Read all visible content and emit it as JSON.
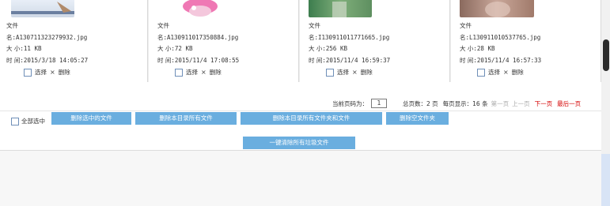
{
  "cards": [
    {
      "type_label": "文件",
      "name_label": "名",
      "name": "A130711323279932.jpg",
      "size_label": "大 小",
      "size": "11 KB",
      "time_label": "时 间",
      "time": "2015/3/18 14:05:27",
      "select_label": "选择",
      "delete_label": "删除"
    },
    {
      "type_label": "文件",
      "name_label": "名",
      "name": "A130911017350884.jpg",
      "size_label": "大 小",
      "size": "72 KB",
      "time_label": "时 间",
      "time": "2015/11/4 17:08:55",
      "select_label": "选择",
      "delete_label": "删除"
    },
    {
      "type_label": "文件",
      "name_label": "名",
      "name": "I130911011771665.jpg",
      "size_label": "大 小",
      "size": "256 KB",
      "time_label": "时 间",
      "time": "2015/11/4 16:59:37",
      "select_label": "选择",
      "delete_label": "删除"
    },
    {
      "type_label": "文件",
      "name_label": "名",
      "name": "L130911010537765.jpg",
      "size_label": "大 小",
      "size": "28 KB",
      "time_label": "时 间",
      "time": "2015/11/4 16:57:33",
      "select_label": "选择",
      "delete_label": "删除"
    }
  ],
  "pager": {
    "current_label": "当前页码为：",
    "current_page": "1",
    "total_label": "总页数：2 页",
    "per_page_label": "每页显示：16 条",
    "first": "第一页",
    "prev": "上一页",
    "next": "下一页",
    "last": "最后一页"
  },
  "bulk": {
    "select_all": "全部选中",
    "delete_selected": "删除选中的文件",
    "delete_dir_files": "删除本目录所有文件",
    "delete_dir_all": "删除本目录所有文件夹和文件",
    "delete_empty_dirs": "删除空文件夹",
    "clear_junk": "一键清除所有垃圾文件"
  },
  "colors": {
    "button": "#6aaedf",
    "accent_red": "#d40000",
    "disabled": "#aaaaaa"
  }
}
